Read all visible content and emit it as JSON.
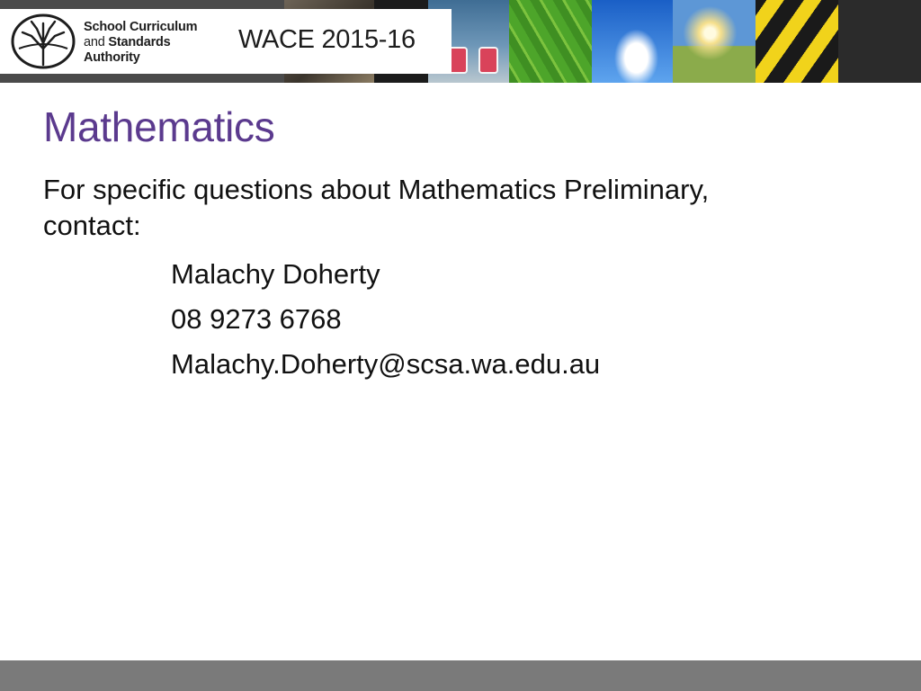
{
  "banner": {
    "org_line1": "School Curriculum",
    "org_line2_prefix": "and ",
    "org_line2_bold": "Standards",
    "org_line3": "Authority",
    "title": "WACE 2015-16"
  },
  "slide": {
    "title": "Mathematics",
    "intro": "For specific questions about Mathematics Preliminary, contact:",
    "contact": {
      "name": "Malachy Doherty",
      "phone": "08 9273 6768",
      "email": "Malachy.Doherty@scsa.wa.edu.au"
    }
  },
  "colors": {
    "title": "#5b3a8e",
    "text": "#111111",
    "footer": "#7a7a7a"
  }
}
